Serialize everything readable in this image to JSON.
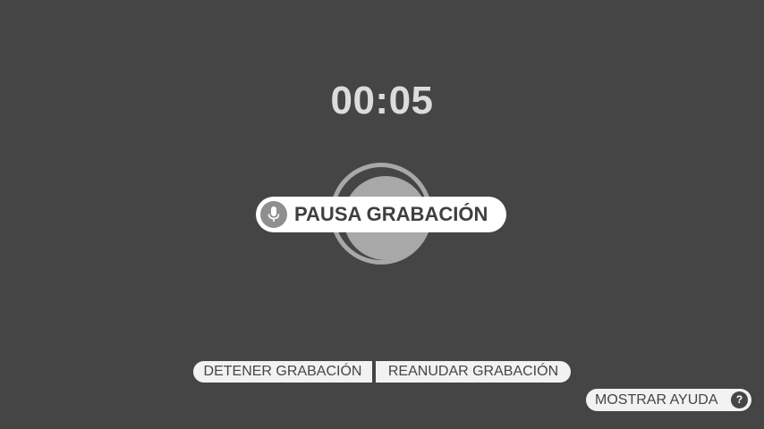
{
  "timer": {
    "elapsed": "00:05"
  },
  "status": {
    "label": "PAUSA GRABACIÓN",
    "icon": "microphone-icon"
  },
  "controls": {
    "stop_label": "DETENER GRABACIÓN",
    "resume_label": "REANUDAR GRABACIÓN"
  },
  "help": {
    "label": "MOSTRAR AYUDA",
    "icon_glyph": "?"
  },
  "colors": {
    "background": "#454545",
    "ring": "#a8a8a8",
    "pill": "#ffffff",
    "button": "#f2f2f2"
  }
}
